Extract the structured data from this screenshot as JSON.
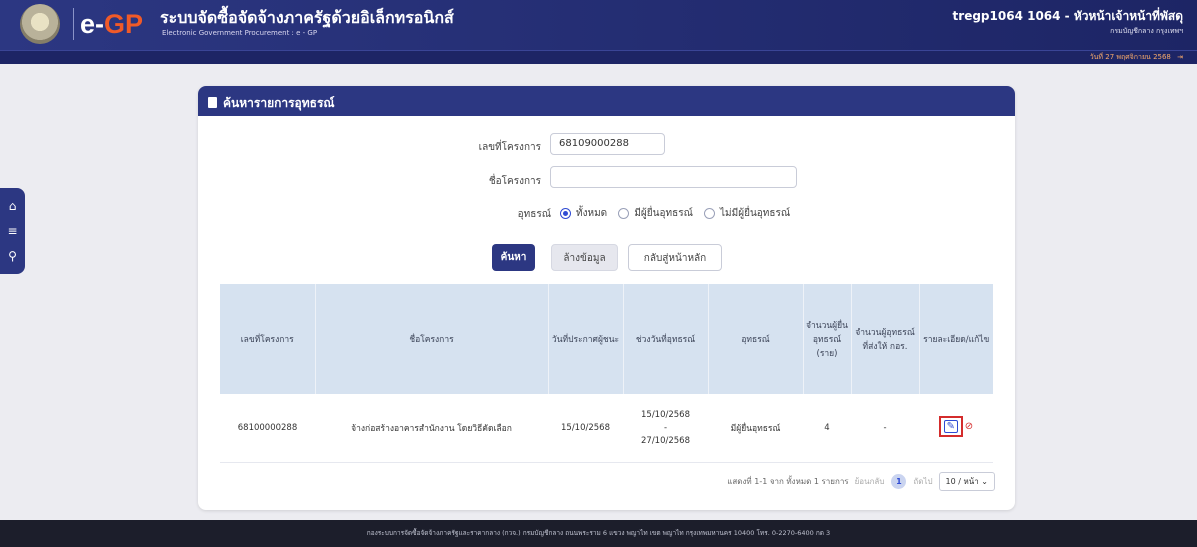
{
  "header": {
    "title": "ระบบจัดซื้อจัดจ้างภาครัฐด้วยอิเล็กทรอนิกส์",
    "subtitle": "Electronic Government Procurement : e - GP",
    "logo_e": "e",
    "logo_dash": "-",
    "logo_gp": "GP",
    "user_name": "tregp1064 1064 - หัวหน้าเจ้าหน้าที่พัสดุ",
    "user_dept": "กรมบัญชีกลาง กรุงเทพฯ",
    "date_text": "วันที่ 27 พฤศจิกายน 2568"
  },
  "card": {
    "title": "ค้นหารายการอุทธรณ์"
  },
  "form": {
    "project_no_label": "เลขที่โครงการ",
    "project_no_value": "68109000288",
    "project_name_label": "ชื่อโครงการ",
    "project_name_value": "",
    "appeal_label": "อุทธรณ์",
    "appeal_options": [
      "ทั้งหมด",
      "มีผู้ยื่นอุทธรณ์",
      "ไม่มีผู้ยื่นอุทธรณ์"
    ],
    "appeal_selected": 0
  },
  "buttons": {
    "search": "ค้นหา",
    "clear": "ล้างข้อมูล",
    "back": "กลับสู่หน้าหลัก"
  },
  "table": {
    "headers": [
      "เลขที่โครงการ",
      "ชื่อโครงการ",
      "วันที่ประกาศผู้ชนะ",
      "ช่วงวันที่อุทธรณ์",
      "อุทธรณ์",
      "จำนวนผู้ยื่นอุทธรณ์ (ราย)",
      "จำนวนผู้อุทธรณ์ที่ส่งให้ กอร.",
      "รายละเอียด/แก้ไข"
    ],
    "rows": [
      {
        "project_no": "68100000288",
        "project_name": "จ้างก่อสร้างอาคารสำนักงาน โดยวิธีคัดเลือก",
        "announce_date": "15/10/2568",
        "appeal_start": "15/10/2568",
        "appeal_sep": "-",
        "appeal_end": "27/10/2568",
        "appeal_status": "มีผู้ยื่นอุทธรณ์",
        "appellant_count": "4",
        "sent_count": "-"
      }
    ]
  },
  "pager": {
    "summary": "แสดงที่ 1-1 จาก ทั้งหมด 1 รายการ",
    "prev": "ย้อนกลับ",
    "page": "1",
    "next": "ถัดไป",
    "per_page": "10 / หน้า"
  },
  "footer": {
    "text": "กองระบบการจัดซื้อจัดจ้างภาครัฐและราคากลาง (กวจ.) กรมบัญชีกลาง ถนนพระราม 6 แขวง พญาไท เขต พญาไท กรุงเทพมหานคร 10400 โทร. 0-2270-6400 กด 3"
  }
}
